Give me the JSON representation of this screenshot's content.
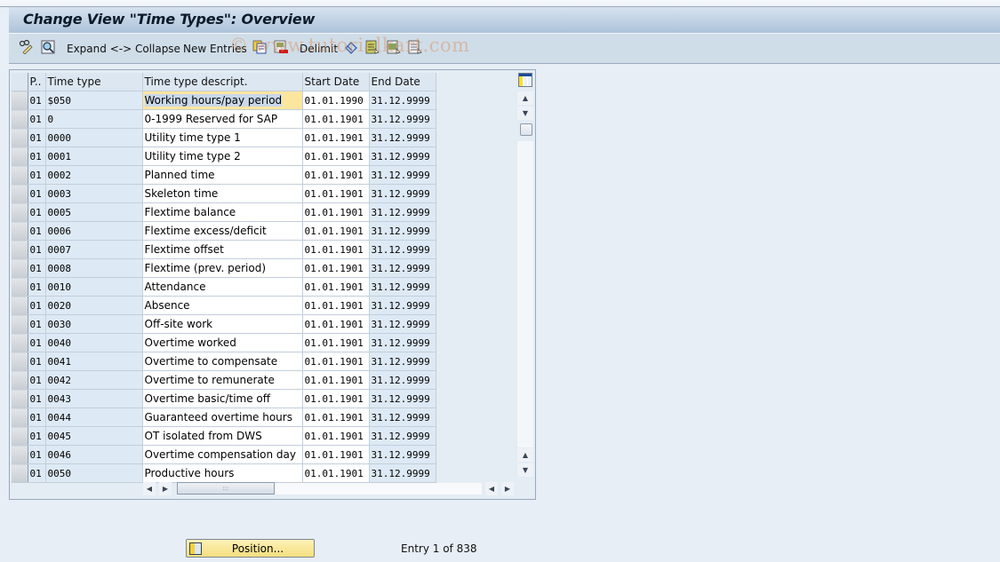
{
  "window": {
    "title": "Change View \"Time Types\": Overview"
  },
  "toolbar": {
    "items": [
      {
        "icon": "edit-glasses-icon",
        "label": ""
      },
      {
        "icon": "display-details-icon",
        "label": ""
      },
      {
        "icon": "",
        "label": "Expand <-> Collapse"
      },
      {
        "icon": "",
        "label": "New Entries"
      },
      {
        "icon": "copy-as-icon",
        "label": ""
      },
      {
        "icon": "delete-icon",
        "label": ""
      },
      {
        "icon": "",
        "label": "Delimit"
      },
      {
        "icon": "undo-change-icon",
        "label": ""
      },
      {
        "icon": "select-all-icon",
        "label": ""
      },
      {
        "icon": "select-block-icon",
        "label": ""
      },
      {
        "icon": "deselect-all-icon",
        "label": ""
      }
    ],
    "watermark": "© www.tutorialkart.com"
  },
  "table": {
    "columns": [
      "P..",
      "Time type",
      "Time type descript.",
      "Start Date",
      "End Date"
    ],
    "rows": [
      {
        "p": "01",
        "type": "$050",
        "desc": "Working hours/pay period",
        "start": "01.01.1990",
        "end": "31.12.9999"
      },
      {
        "p": "01",
        "type": "0",
        "desc": "0-1999 Reserved for SAP",
        "start": "01.01.1901",
        "end": "31.12.9999"
      },
      {
        "p": "01",
        "type": "0000",
        "desc": "Utility time type 1",
        "start": "01.01.1901",
        "end": "31.12.9999"
      },
      {
        "p": "01",
        "type": "0001",
        "desc": "Utility time type 2",
        "start": "01.01.1901",
        "end": "31.12.9999"
      },
      {
        "p": "01",
        "type": "0002",
        "desc": "Planned time",
        "start": "01.01.1901",
        "end": "31.12.9999"
      },
      {
        "p": "01",
        "type": "0003",
        "desc": "Skeleton time",
        "start": "01.01.1901",
        "end": "31.12.9999"
      },
      {
        "p": "01",
        "type": "0005",
        "desc": "Flextime balance",
        "start": "01.01.1901",
        "end": "31.12.9999"
      },
      {
        "p": "01",
        "type": "0006",
        "desc": "Flextime excess/deficit",
        "start": "01.01.1901",
        "end": "31.12.9999"
      },
      {
        "p": "01",
        "type": "0007",
        "desc": "Flextime offset",
        "start": "01.01.1901",
        "end": "31.12.9999"
      },
      {
        "p": "01",
        "type": "0008",
        "desc": "Flextime (prev. period)",
        "start": "01.01.1901",
        "end": "31.12.9999"
      },
      {
        "p": "01",
        "type": "0010",
        "desc": "Attendance",
        "start": "01.01.1901",
        "end": "31.12.9999"
      },
      {
        "p": "01",
        "type": "0020",
        "desc": "Absence",
        "start": "01.01.1901",
        "end": "31.12.9999"
      },
      {
        "p": "01",
        "type": "0030",
        "desc": "Off-site work",
        "start": "01.01.1901",
        "end": "31.12.9999"
      },
      {
        "p": "01",
        "type": "0040",
        "desc": "Overtime worked",
        "start": "01.01.1901",
        "end": "31.12.9999"
      },
      {
        "p": "01",
        "type": "0041",
        "desc": "Overtime to compensate",
        "start": "01.01.1901",
        "end": "31.12.9999"
      },
      {
        "p": "01",
        "type": "0042",
        "desc": "Overtime to remunerate",
        "start": "01.01.1901",
        "end": "31.12.9999"
      },
      {
        "p": "01",
        "type": "0043",
        "desc": "Overtime basic/time off",
        "start": "01.01.1901",
        "end": "31.12.9999"
      },
      {
        "p": "01",
        "type": "0044",
        "desc": "Guaranteed overtime hours",
        "start": "01.01.1901",
        "end": "31.12.9999"
      },
      {
        "p": "01",
        "type": "0045",
        "desc": "OT isolated from DWS",
        "start": "01.01.1901",
        "end": "31.12.9999"
      },
      {
        "p": "01",
        "type": "0046",
        "desc": "Overtime compensation day",
        "start": "01.01.1901",
        "end": "31.12.9999"
      },
      {
        "p": "01",
        "type": "0050",
        "desc": "Productive hours",
        "start": "01.01.1901",
        "end": "31.12.9999"
      }
    ]
  },
  "footer": {
    "position_button": "Position...",
    "entry_info": "Entry 1 of 838"
  }
}
